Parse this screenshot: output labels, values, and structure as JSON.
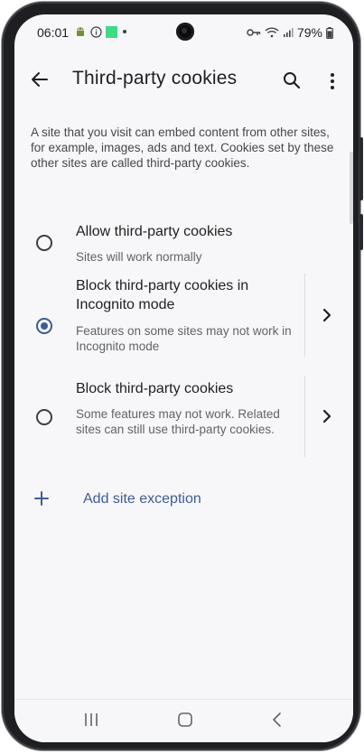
{
  "status_bar": {
    "time": "06:01",
    "battery": "79%",
    "left_icons": [
      "android-icon",
      "info-icon",
      "green-square-icon",
      "dot-icon"
    ],
    "right_icons": [
      "key-icon",
      "wifi-icon",
      "signal-icon",
      "battery-icon"
    ]
  },
  "app_bar": {
    "title": "Third-party cookies",
    "back_icon": "arrow-back-icon",
    "search_icon": "search-icon",
    "more_icon": "more-vert-icon"
  },
  "description": "A site that you visit can embed content from other sites, for example, images, ads and text. Cookies set by these other sites are called third-party cookies.",
  "options": [
    {
      "title": "Allow third-party cookies",
      "subtitle": "Sites will work normally",
      "selected": false,
      "has_chevron": false
    },
    {
      "title": "Block third-party cookies in Incognito mode",
      "subtitle": "Features on some sites may not work in Incognito mode",
      "selected": true,
      "has_chevron": true
    },
    {
      "title": "Block third-party cookies",
      "subtitle": "Some features may not work. Related sites can still use third-party cookies.",
      "selected": false,
      "has_chevron": true
    }
  ],
  "add_exception": {
    "label": "Add site exception",
    "icon": "plus-icon"
  },
  "nav_bar": {
    "recents_icon": "recents-icon",
    "home_icon": "home-icon",
    "back_icon": "nav-back-icon"
  },
  "colors": {
    "accent": "#3d5c96",
    "background": "#f7f7f9",
    "text_primary": "#1f1f1f",
    "text_secondary": "#5f6368"
  }
}
